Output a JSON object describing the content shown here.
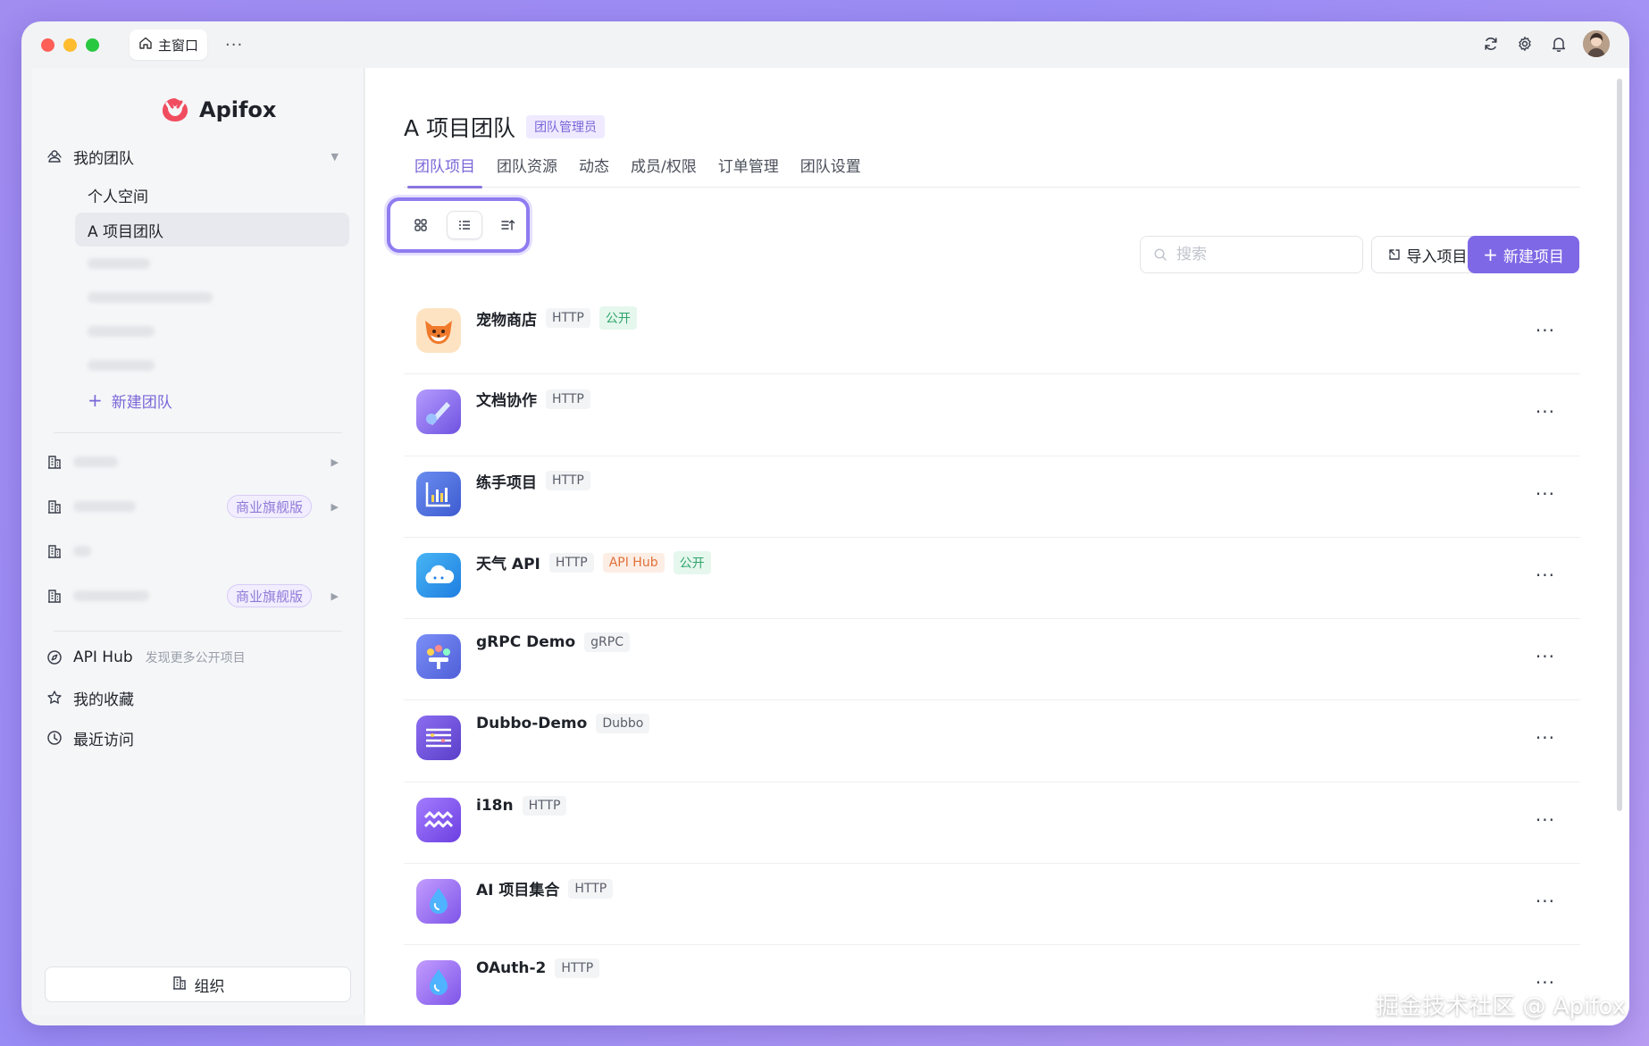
{
  "titlebar": {
    "tab_label": "主窗口",
    "more": "···"
  },
  "logo": {
    "text": "Apifox"
  },
  "sidebar": {
    "my_teams": "我的团队",
    "personal_space": "个人空间",
    "active_team": "A 项目团队",
    "new_team": "新建团队",
    "orgs": [
      {
        "badge": ""
      },
      {
        "badge": "商业旗舰版"
      },
      {
        "badge": ""
      },
      {
        "badge": "商业旗舰版"
      }
    ],
    "api_hub": "API Hub",
    "api_hub_desc": "发现更多公开项目",
    "favorites": "我的收藏",
    "recent": "最近访问",
    "org_button": "组织"
  },
  "main": {
    "title": "A 项目团队",
    "role_badge": "团队管理员",
    "tabs": [
      "团队项目",
      "团队资源",
      "动态",
      "成员/权限",
      "订单管理",
      "团队设置"
    ],
    "search_placeholder": "搜索",
    "import_label": "导入项目",
    "new_label": "新建项目",
    "projects": [
      {
        "name": "宠物商店",
        "type": "HTTP",
        "tags": [
          {
            "text": "公开",
            "kind": "green"
          }
        ],
        "icon": "fox-icon"
      },
      {
        "name": "文档协作",
        "type": "HTTP",
        "tags": [],
        "icon": "comet-icon"
      },
      {
        "name": "练手项目",
        "type": "HTTP",
        "tags": [],
        "icon": "chart-icon"
      },
      {
        "name": "天气 API",
        "type": "HTTP",
        "tags": [
          {
            "text": "API Hub",
            "kind": "orange"
          },
          {
            "text": "公开",
            "kind": "green"
          }
        ],
        "icon": "cloud-icon"
      },
      {
        "name": "gRPC Demo",
        "type": "gRPC",
        "tags": [],
        "icon": "team-icon"
      },
      {
        "name": "Dubbo-Demo",
        "type": "Dubbo",
        "tags": [],
        "icon": "lines-icon"
      },
      {
        "name": "i18n",
        "type": "HTTP",
        "tags": [],
        "icon": "wave-icon"
      },
      {
        "name": "AI 项目集合",
        "type": "HTTP",
        "tags": [],
        "icon": "drop-icon"
      },
      {
        "name": "OAuth-2",
        "type": "HTTP",
        "tags": [],
        "icon": "drop-icon"
      }
    ]
  },
  "watermark": "掘金技术社区 @ Apifox",
  "colors": {
    "accent": "#7f68e6",
    "red_light": "#fe5f57",
    "yellow_light": "#febc2e",
    "green_light": "#28c840"
  }
}
